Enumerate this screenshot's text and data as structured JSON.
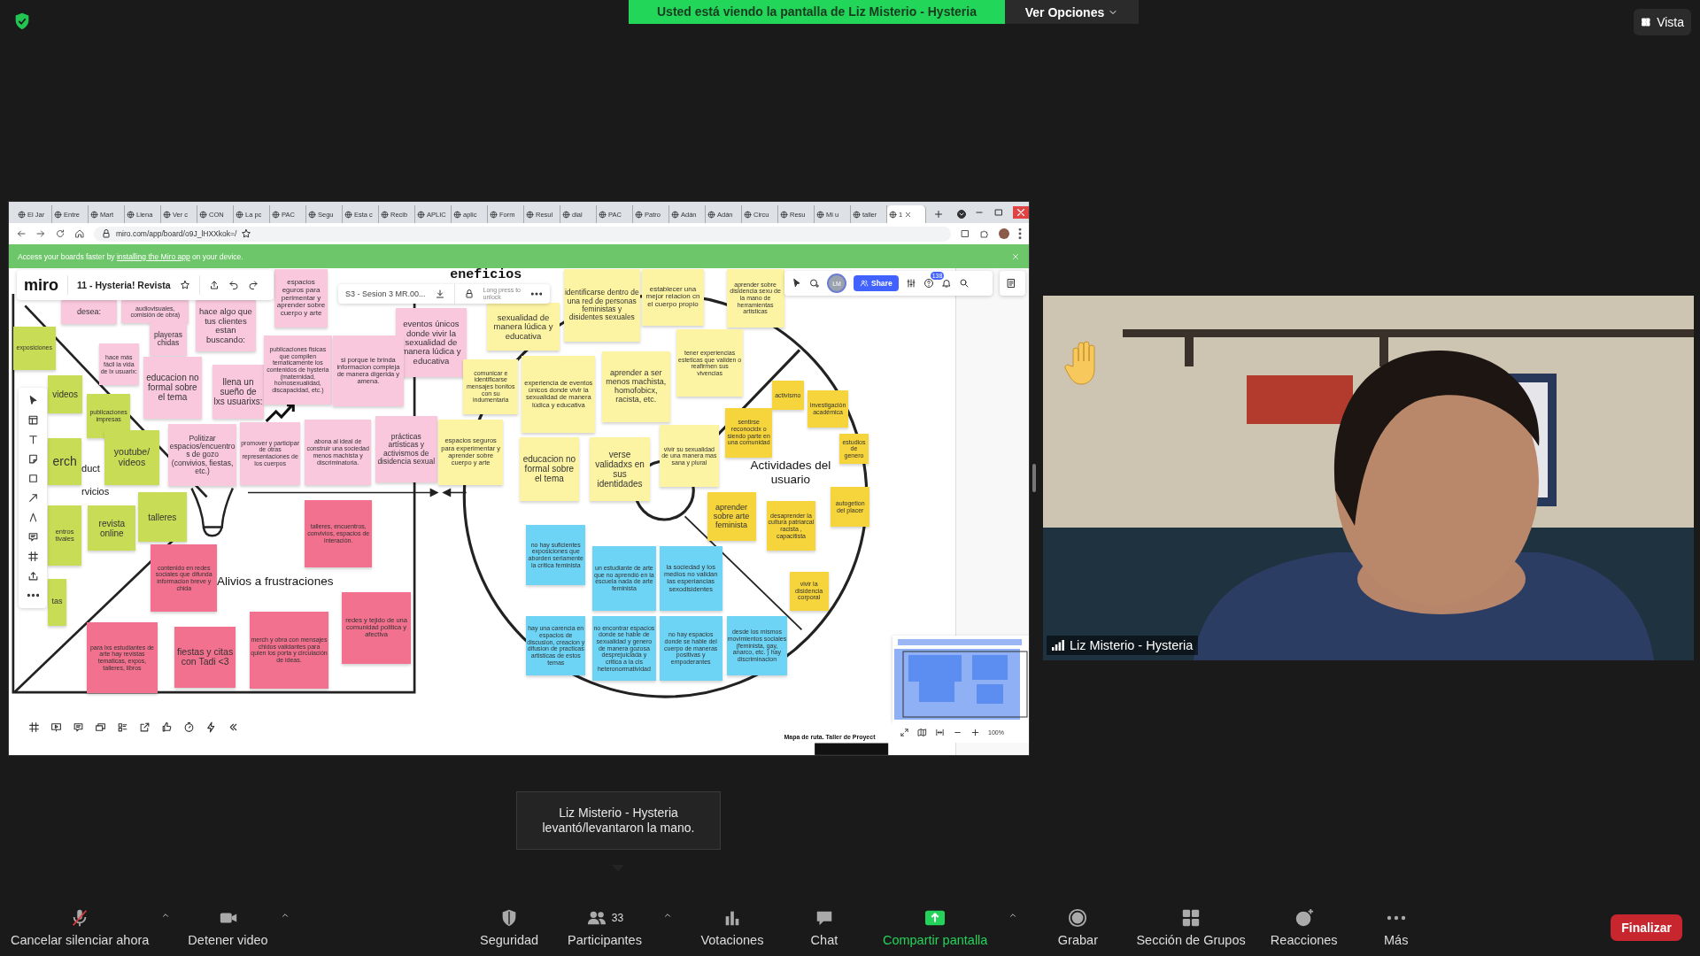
{
  "zoom_top": {
    "sharing_banner": "Usted está viendo la pantalla de Liz Misterio - Hysteria",
    "view_options": "Ver Opciones",
    "view": "Vista"
  },
  "shared_screen": {
    "browser": {
      "tabs": [
        {
          "label": "El Jar",
          "selected": false
        },
        {
          "label": "Entre",
          "selected": false
        },
        {
          "label": "Mart",
          "selected": false
        },
        {
          "label": "Llena",
          "selected": false
        },
        {
          "label": "Ver c",
          "selected": false
        },
        {
          "label": "CON",
          "selected": false
        },
        {
          "label": "La pc",
          "selected": false
        },
        {
          "label": "PAC",
          "selected": false
        },
        {
          "label": "Segu",
          "selected": false
        },
        {
          "label": "Esta c",
          "selected": false
        },
        {
          "label": "Recib",
          "selected": false
        },
        {
          "label": "APLIC",
          "selected": false
        },
        {
          "label": "aplic",
          "selected": false
        },
        {
          "label": "Form",
          "selected": false
        },
        {
          "label": "Resul",
          "selected": false
        },
        {
          "label": "dial",
          "selected": false
        },
        {
          "label": "PAC",
          "selected": false
        },
        {
          "label": "Patro",
          "selected": false
        },
        {
          "label": "Adán",
          "selected": false
        },
        {
          "label": "Adán",
          "selected": false
        },
        {
          "label": "Circu",
          "selected": false
        },
        {
          "label": "Resu",
          "selected": false
        },
        {
          "label": "Mi u",
          "selected": false
        },
        {
          "label": "taller",
          "selected": false
        },
        {
          "label": "1",
          "selected": true
        }
      ],
      "address": "miro.com/app/board/o9J_lHXXkok=/",
      "banner": {
        "text_before": "Access your boards faster by",
        "link": "installing the Miro app",
        "text_after": "on your device."
      }
    },
    "miro": {
      "logo": "miro",
      "board_name": "11 - Hysteria! Revista",
      "frame_name": "S3 - Sesion 3 MR.00...",
      "lock_hint": "Long press to unlock",
      "avatar": "LM",
      "share": "Share",
      "help_badge": "138",
      "zoom_level": "100%"
    },
    "canvas": {
      "labels": [
        {
          "text": "eneficios",
          "kind": "heading"
        },
        {
          "text": "duct",
          "kind": "plain"
        },
        {
          "text": "rvicios",
          "kind": "plain"
        },
        {
          "text": "Actividades del usuario",
          "kind": "section"
        },
        {
          "text": "Alivios a frustraciones",
          "kind": "section"
        },
        {
          "text": "Mapa de ruta. Taller de Proyect",
          "kind": "caption"
        }
      ],
      "notes": [
        {
          "text": "desea:",
          "color": "#f9c8dc"
        },
        {
          "text": "audiovisuales, comisión de obra)",
          "color": "#f9c8dc"
        },
        {
          "text": "hace algo que tus clientes estan buscando:",
          "color": "#f9c8dc"
        },
        {
          "text": "espacios eguros para perimentar y aprender sobre cuerpo y arte",
          "color": "#f9c8dc"
        },
        {
          "text": "eventos únicos donde vivir la sexualidad de manera lúdica y educativa",
          "color": "#f9c8dc"
        },
        {
          "text": "sexualidad de manera lúdica y educativa",
          "color": "#fdf4a3"
        },
        {
          "text": "identificarse dentro de una red de personas feministas y disidentes sexuales",
          "color": "#fdf4a3"
        },
        {
          "text": "establecer una mejor relacion cn el cuerpo propio",
          "color": "#fdf4a3"
        },
        {
          "text": "aprender sobre disidencia sexu de la mano de herramientas artisticas",
          "color": "#fdf4a3"
        },
        {
          "text": "exposiciones",
          "color": "#c8dd55"
        },
        {
          "text": "hace más fácil la vida de lx usuarix:",
          "color": "#f9c8dc"
        },
        {
          "text": "playeras chidas",
          "color": "#f9c8dc"
        },
        {
          "text": "educacion no formal sobre el tema",
          "color": "#f9c8dc"
        },
        {
          "text": "llena un sueño de lxs usuarixs:",
          "color": "#f9c8dc"
        },
        {
          "text": "publicaciones fisicas que compilen tematicamente los contenidos de hysteria (maternidad, homosexualidad, discapacidad, etc.)",
          "color": "#f9c8dc"
        },
        {
          "text": "si porque le brinda informacion compleja de manera digerida y amena.",
          "color": "#f9c8dc"
        },
        {
          "text": "videos",
          "color": "#c8dd55"
        },
        {
          "text": "publicaciones impresas",
          "color": "#c8dd55"
        },
        {
          "text": "erch",
          "color": "#c8dd55"
        },
        {
          "text": "youtube/ videos",
          "color": "#c8dd55"
        },
        {
          "text": "Politizar espacios/encuentros de gozo (convivios, fiestas, etc.)",
          "color": "#f9c8dc"
        },
        {
          "text": "promover y participar de otras representaciones de los cuerpos",
          "color": "#f9c8dc"
        },
        {
          "text": "abona al ideal de construir una sociedad menos machista y discriminatoria.",
          "color": "#f9c8dc"
        },
        {
          "text": "prácticas artísticas y activismos de disidencia sexual",
          "color": "#f9c8dc"
        },
        {
          "text": "comunicar e identificarse mensajes bonitos con su indumentaria",
          "color": "#fdf4a3"
        },
        {
          "text": "espacios seguros para experimentar y aprender sobre cuerpo y arte",
          "color": "#fdf4a3"
        },
        {
          "text": "experiencia de eventos únicos donde vivir la sexualidad de manera lúdica y educativa",
          "color": "#fdf4a3"
        },
        {
          "text": "aprender a ser menos machista, homofobicx, racista, etc.",
          "color": "#fdf4a3"
        },
        {
          "text": "tener experiencias esteticas que validen o reafirmen sus vivencias",
          "color": "#fdf4a3"
        },
        {
          "text": "activismo",
          "color": "#f6d43c"
        },
        {
          "text": "investigación académica",
          "color": "#f6d43c"
        },
        {
          "text": "sentirse reconocidx o siendo parte en una comunidad",
          "color": "#f6d43c"
        },
        {
          "text": "estudios de genero",
          "color": "#f6d43c"
        },
        {
          "text": "educacion no formal sobre el tema",
          "color": "#fdf4a3"
        },
        {
          "text": "verse validadxs en sus identidades",
          "color": "#fdf4a3"
        },
        {
          "text": "vivir su sexualidad de una manera mas sana y plural",
          "color": "#fdf4a3"
        },
        {
          "text": "aprender sobre arte feminista",
          "color": "#f6d43c"
        },
        {
          "text": "desaprender la cultura patriarcal racista , capacitista",
          "color": "#f6d43c"
        },
        {
          "text": "autogetion del placer",
          "color": "#f6d43c"
        },
        {
          "text": "vivir la disidencia corporal",
          "color": "#f6d43c"
        },
        {
          "text": "no hay suficientes exposiciones que aborden seriamente la critica feminista",
          "color": "#6dd4f6"
        },
        {
          "text": "un estudiante de arte que no aprendió en la escuela nada de arte feminista",
          "color": "#6dd4f6"
        },
        {
          "text": "la sociedad y los medios no validan las esperiancias sexodisidentes",
          "color": "#6dd4f6"
        },
        {
          "text": "hay una carencia en espacios de discusion, creacion y difusion de practicas artisticas de estos temas",
          "color": "#6dd4f6"
        },
        {
          "text": "no encontrar espacios donde se hable de sexualidad y genero de manera gozosa desprejuiciada y critica a la cis heteronormatividad",
          "color": "#6dd4f6"
        },
        {
          "text": "no hay espacios donde se hable del cuerpo de maneras positivas y empoderantes",
          "color": "#6dd4f6"
        },
        {
          "text": "desde los mismos movimientos sociales (feminista, gay, anarco, etc. ) hay discriminacion",
          "color": "#6dd4f6"
        },
        {
          "text": "revista online",
          "color": "#c8dd55"
        },
        {
          "text": "talleres",
          "color": "#c8dd55"
        },
        {
          "text": "entros tivales",
          "color": "#c8dd55"
        },
        {
          "text": "tas",
          "color": "#c8dd55"
        },
        {
          "text": "contenido en redes sociales que difunda informacion breve y chida",
          "color": "#f2718e"
        },
        {
          "text": "talleres, encuentros, convivios, espacios de interación.",
          "color": "#f2718e"
        },
        {
          "text": "para lxs estudiantes de arte hay revistas tematicas, expos, talleres, libros",
          "color": "#f2718e"
        },
        {
          "text": "fiestas y citas con Tadi <3",
          "color": "#f2718e"
        },
        {
          "text": "merch y obra con mensajes chidos validantes para quien los porta y circulación de ideas.",
          "color": "#f2718e"
        },
        {
          "text": "redes y tejido de una comunidad politica y afectiva",
          "color": "#f2718e"
        }
      ]
    }
  },
  "video": {
    "name": "Liz Misterio - Hysteria",
    "hand_raised": true
  },
  "notification": "Liz Misterio - Hysteria levantó/levantaron la mano.",
  "toolbar": {
    "items": [
      {
        "label": "Cancelar silenciar ahora",
        "kind": "mic",
        "caret": true
      },
      {
        "label": "Detener video",
        "kind": "video",
        "caret": true
      },
      {
        "label": "Seguridad",
        "kind": "security",
        "caret": false
      },
      {
        "label": "Participantes",
        "kind": "participants",
        "caret": true,
        "count": "33"
      },
      {
        "label": "Votaciones",
        "kind": "polls",
        "caret": false
      },
      {
        "label": "Chat",
        "kind": "chat",
        "caret": false
      },
      {
        "label": "Compartir pantalla",
        "kind": "share",
        "caret": true
      },
      {
        "label": "Grabar",
        "kind": "record",
        "caret": false
      },
      {
        "label": "Sección de Grupos",
        "kind": "breakout",
        "caret": false
      },
      {
        "label": "Reacciones",
        "kind": "reactions",
        "caret": false
      },
      {
        "label": "Más",
        "kind": "more",
        "caret": false
      }
    ],
    "end": "Finalizar"
  }
}
